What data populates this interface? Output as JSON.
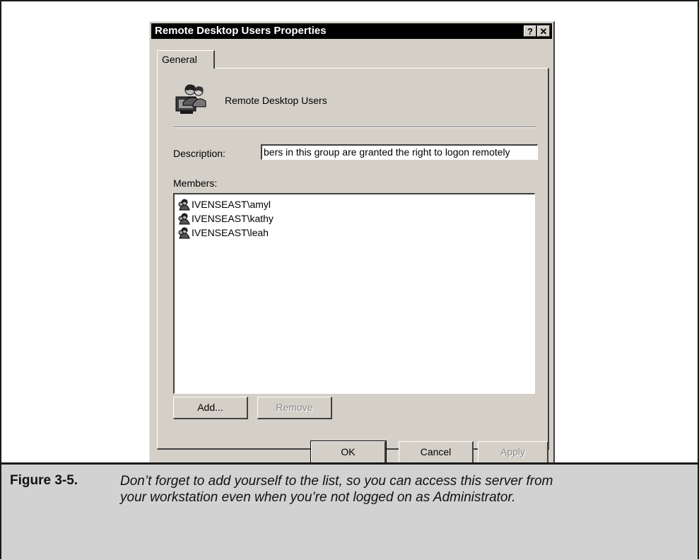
{
  "dialog": {
    "title": "Remote Desktop Users Properties",
    "help_button": "?",
    "close_button": "✕",
    "tab_general": "General",
    "group_name": "Remote Desktop Users",
    "description_label": "Description:",
    "description_value": "bers in this group are granted the right to logon remotely",
    "members_label": "Members:",
    "members": [
      "IVENSEAST\\amyl",
      "IVENSEAST\\kathy",
      "IVENSEAST\\leah"
    ],
    "add_label": "Add...",
    "remove_label": "Remove",
    "ok_label": "OK",
    "cancel_label": "Cancel",
    "apply_label": "Apply",
    "icons": {
      "group": "users-group-icon",
      "member": "user-icon"
    }
  },
  "caption": {
    "label": "Figure 3-5.",
    "text": "Don’t forget to add yourself to the list, so you can access this server from your workstation even when you’re not logged on as Administrator."
  }
}
